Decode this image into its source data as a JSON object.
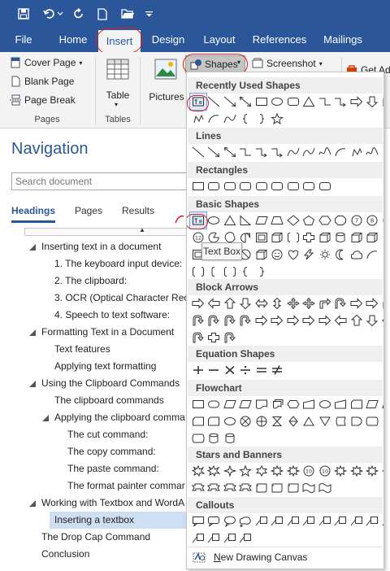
{
  "window": {
    "tabs": [
      "File",
      "Home",
      "Insert",
      "Design",
      "Layout",
      "References",
      "Mailings"
    ],
    "active_tab": "Insert"
  },
  "ribbon": {
    "pages_group": {
      "label": "Pages",
      "items": [
        "Cover Page",
        "Blank Page",
        "Page Break"
      ]
    },
    "tables_group": {
      "label": "Tables",
      "table_label": "Table"
    },
    "pictures_label": "Pictures",
    "shapes_label": "Shapes",
    "screenshot_label": "Screenshot",
    "get_addins_label": "Get Add"
  },
  "navigation": {
    "title": "Navigation",
    "search_placeholder": "Search document",
    "tabs": [
      "Headings",
      "Pages",
      "Results"
    ],
    "active_tab": "Headings",
    "headings": [
      {
        "level": 1,
        "text": "Inserting text in a document",
        "expanded": true
      },
      {
        "level": 2,
        "text": "1. The keyboard input device:"
      },
      {
        "level": 2,
        "text": "2. The clipboard:"
      },
      {
        "level": 2,
        "text": "3. OCR (Optical Character Reco"
      },
      {
        "level": 2,
        "text": "4. Speech to text software:"
      },
      {
        "level": 1,
        "text": "Formatting Text in a Document",
        "expanded": true
      },
      {
        "level": 2,
        "text": "Text features"
      },
      {
        "level": 2,
        "text": "Applying text formatting"
      },
      {
        "level": 1,
        "text": "Using the Clipboard Commands",
        "expanded": true
      },
      {
        "level": 2,
        "text": "The clipboard commands"
      },
      {
        "level": 2,
        "text": "Applying the clipboard comma",
        "expanded": true
      },
      {
        "level": 3,
        "text": "The cut command:"
      },
      {
        "level": 3,
        "text": "The copy command:"
      },
      {
        "level": 3,
        "text": "The paste command:"
      },
      {
        "level": 3,
        "text": "The format painter commar"
      },
      {
        "level": 1,
        "text": "Working with Textbox and WordA",
        "expanded": true
      },
      {
        "level": 2,
        "text": "Inserting a textbox",
        "selected": true
      },
      {
        "level": 1,
        "text": "The Drop Cap Command"
      },
      {
        "level": 1,
        "text": "Conclusion"
      }
    ]
  },
  "shapes_menu": {
    "sections": [
      "Recently Used Shapes",
      "Lines",
      "Rectangles",
      "Basic Shapes",
      "Block Arrows",
      "Equation Shapes",
      "Flowchart",
      "Stars and Banners",
      "Callouts"
    ],
    "tooltip": "Text Box",
    "new_canvas_prefix": "N",
    "new_canvas_rest": "ew Drawing Canvas"
  },
  "colors": {
    "accent": "#2b579a",
    "annotation_red": "#e0201c",
    "selection": "#cfdff3"
  }
}
